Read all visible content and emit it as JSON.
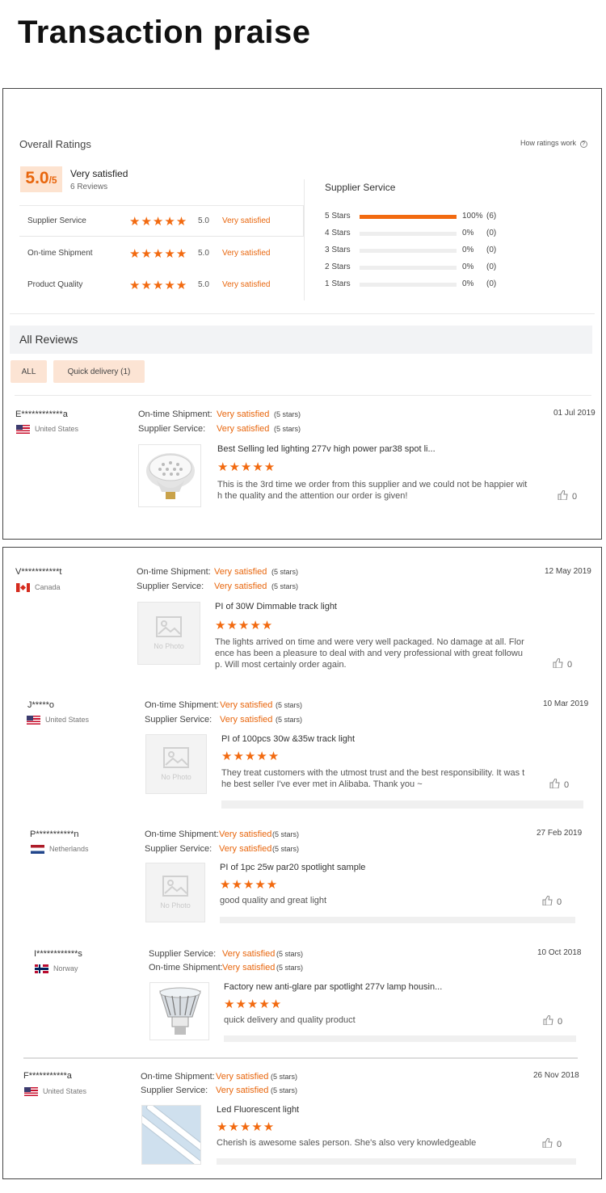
{
  "page_title": "Transaction praise",
  "colors": {
    "accent": "#f26a10",
    "accent_text": "#e8660d",
    "score_bg": "#fde3d0",
    "tab_bg": "#fce4d4",
    "header_bg": "#f2f3f5"
  },
  "overall": {
    "heading": "Overall Ratings",
    "how_link": "How ratings work",
    "score": "5.0",
    "score_suffix": "/5",
    "verdict": "Very satisfied",
    "reviews_count": "6 Reviews",
    "rows": [
      {
        "label": "Supplier Service",
        "stars": 5,
        "score": "5.0",
        "verdict": "Very satisfied"
      },
      {
        "label": "On-time Shipment",
        "stars": 5,
        "score": "5.0",
        "verdict": "Very satisfied"
      },
      {
        "label": "Product Quality",
        "stars": 5,
        "score": "5.0",
        "verdict": "Very satisfied"
      }
    ],
    "breakdown_title": "Supplier Service",
    "breakdown": [
      {
        "label": "5 Stars",
        "fill": 1.0,
        "pct": "100%",
        "count": "(6)"
      },
      {
        "label": "4 Stars",
        "fill": 0,
        "pct": "0%",
        "count": "(0)"
      },
      {
        "label": "3 Stars",
        "fill": 0,
        "pct": "0%",
        "count": "(0)"
      },
      {
        "label": "2 Stars",
        "fill": 0,
        "pct": "0%",
        "count": "(0)"
      },
      {
        "label": "1 Stars",
        "fill": 0,
        "pct": "0%",
        "count": "(0)"
      }
    ]
  },
  "all_reviews": {
    "heading": "All Reviews",
    "filters": [
      "ALL",
      "Quick delivery (1)"
    ]
  },
  "star_glyphs": "★★★★★",
  "no_photo": "No Photo",
  "reviews": [
    {
      "name": "E************a",
      "country": "United States",
      "flag": "us",
      "date": "01 Jul 2019",
      "ratings": [
        {
          "label": "On-time Shipment:",
          "value": "Very satisfied",
          "stars": "(5 stars)"
        },
        {
          "label": "Supplier Service:",
          "value": "Very satisfied",
          "stars": "(5 stars)"
        }
      ],
      "product": "Best Selling led lighting 277v high power par38 spot li...",
      "text1": "This is the 3rd time we order from this supplier and we could not be happier wit",
      "text2": "h the quality and the attention our order is given!",
      "text3": "",
      "likes": "0"
    },
    {
      "name": "V***********t",
      "country": "Canada",
      "flag": "ca",
      "date": "12 May 2019",
      "ratings": [
        {
          "label": "On-time Shipment:",
          "value": "Very satisfied",
          "stars": "(5 stars)"
        },
        {
          "label": "Supplier Service:",
          "value": "Very satisfied",
          "stars": "(5 stars)"
        }
      ],
      "product": "PI of 30W Dimmable track light",
      "text1": "The lights arrived on time and were very well packaged.  No damage at all. Flor",
      "text2": "ence has been a pleasure to deal with and very professional with great followu",
      "text3": "p.  Will most certainly order again.",
      "likes": "0"
    },
    {
      "name": "J*****o",
      "country": "United States",
      "flag": "us",
      "date": "10 Mar 2019",
      "ratings": [
        {
          "label": "On-time Shipment:",
          "value": "Very satisfied",
          "stars": "(5 stars)"
        },
        {
          "label": "Supplier Service:",
          "value": "Very satisfied",
          "stars": "(5 stars)"
        }
      ],
      "product": "PI of 100pcs 30w &35w track light",
      "text1": "They treat customers with the utmost trust and the best responsibility. It was t",
      "text2": "he best seller I've ever met in Alibaba. Thank you ~",
      "text3": "",
      "likes": "0"
    },
    {
      "name": "P***********n",
      "country": "Netherlands",
      "flag": "nl",
      "date": "27 Feb 2019",
      "ratings": [
        {
          "label": "On-time Shipment:",
          "value": "Very satisfied",
          "stars": "(5 stars)"
        },
        {
          "label": "Supplier Service:",
          "value": "Very satisfied",
          "stars": "(5 stars)"
        }
      ],
      "product": "PI of 1pc 25w par20 spotlight sample",
      "text1": "good quality and great light",
      "text2": "",
      "text3": "",
      "likes": "0"
    },
    {
      "name": "I************s",
      "country": "Norway",
      "flag": "no",
      "date": "10 Oct 2018",
      "ratings": [
        {
          "label": "Supplier Service:",
          "value": "Very satisfied",
          "stars": "(5 stars)"
        },
        {
          "label": "On-time Shipment:",
          "value": "Very satisfied",
          "stars": "(5 stars)"
        }
      ],
      "product": "Factory new anti-glare par spotlight 277v lamp housin...",
      "text1": "quick delivery and quality product",
      "text2": "",
      "text3": "",
      "likes": "0"
    },
    {
      "name": "F***********a",
      "country": "United States",
      "flag": "us",
      "date": "26 Nov 2018",
      "ratings": [
        {
          "label": "On-time Shipment:",
          "value": "Very satisfied",
          "stars": "(5 stars)"
        },
        {
          "label": "Supplier Service:",
          "value": "Very satisfied",
          "stars": "(5 stars)"
        }
      ],
      "product": "Led Fluorescent light",
      "text1": "Cherish is awesome sales person. She's also very knowledgeable",
      "text2": "",
      "text3": "",
      "likes": "0"
    }
  ]
}
